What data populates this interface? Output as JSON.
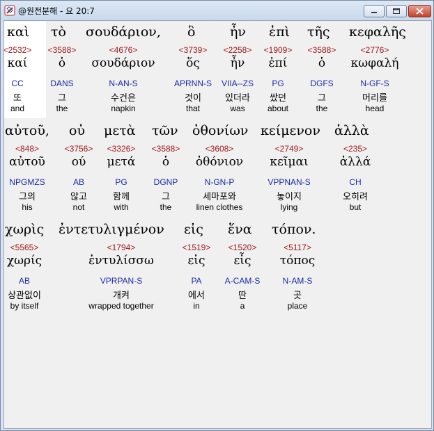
{
  "window": {
    "title": "@원전분해 - 요 20:7",
    "app_icon": "book-icon",
    "controls": [
      "minimize-icon",
      "maximize-icon",
      "close-icon"
    ]
  },
  "rows": [
    {
      "words": [
        {
          "greek": "καὶ",
          "strong": "<2532>",
          "lemma": "καί",
          "parse": "CC",
          "kor": "또",
          "eng": "and"
        },
        {
          "greek": "τὸ",
          "strong": "<3588>",
          "lemma": "ὁ",
          "parse": "DANS",
          "kor": "그",
          "eng": "the"
        },
        {
          "greek": "σουδάριον,",
          "strong": "<4676>",
          "lemma": "σουδάριον",
          "parse": "N-AN-S",
          "kor": "수건은",
          "eng": "napkin"
        },
        {
          "greek": "ὃ",
          "strong": "<3739>",
          "lemma": "ὅς",
          "parse": "APRNN-S",
          "kor": "것이",
          "eng": "that"
        },
        {
          "greek": "ἦν",
          "strong": "<2258>",
          "lemma": "ἦν",
          "parse": "VIIA--ZS",
          "kor": "있더라",
          "eng": "was"
        },
        {
          "greek": "ἐπὶ",
          "strong": "<1909>",
          "lemma": "ἐπί",
          "parse": "PG",
          "kor": "쌌던",
          "eng": "about"
        },
        {
          "greek": "τῆς",
          "strong": "<3588>",
          "lemma": "ὁ",
          "parse": "DGFS",
          "kor": "그",
          "eng": "the"
        },
        {
          "greek": "κεφαλῆς",
          "strong": "<2776>",
          "lemma": "κωφαλή",
          "parse": "N-GF-S",
          "kor": "머리를",
          "eng": "head"
        }
      ]
    },
    {
      "words": [
        {
          "greek": "αὐτοῦ,",
          "strong": "<848>",
          "lemma": "αὐτοῦ",
          "parse": "NPGMZS",
          "kor": "그의",
          "eng": "his"
        },
        {
          "greek": "οὐ",
          "strong": "<3756>",
          "lemma": "ού",
          "parse": "AB",
          "kor": "않고",
          "eng": "not"
        },
        {
          "greek": "μετὰ",
          "strong": "<3326>",
          "lemma": "μετά",
          "parse": "PG",
          "kor": "함께",
          "eng": "with"
        },
        {
          "greek": "τῶν",
          "strong": "<3588>",
          "lemma": "ὁ",
          "parse": "DGNP",
          "kor": "그",
          "eng": "the"
        },
        {
          "greek": "ὀθονίων",
          "strong": "<3608>",
          "lemma": "ὀθόνιον",
          "parse": "N-GN-P",
          "kor": "세마포와",
          "eng": "linen clothes"
        },
        {
          "greek": "κείμενον",
          "strong": "<2749>",
          "lemma": "κεῖμαι",
          "parse": "VPPNAN-S",
          "kor": "놓이지",
          "eng": "lying"
        },
        {
          "greek": "ἀλλὰ",
          "strong": "<235>",
          "lemma": "ἀλλά",
          "parse": "CH",
          "kor": "오히려",
          "eng": "but"
        }
      ]
    },
    {
      "words": [
        {
          "greek": "χωρὶς",
          "strong": "<5565>",
          "lemma": "χωρίς",
          "parse": "AB",
          "kor": "상관없이",
          "eng": "by itself"
        },
        {
          "greek": "ἐντετυλιγμένον",
          "strong": "<1794>",
          "lemma": "ἐντυλίσσω",
          "parse": "VPRPAN-S",
          "kor": "개켜",
          "eng": "wrapped together"
        },
        {
          "greek": "εἰς",
          "strong": "<1519>",
          "lemma": "εἰς",
          "parse": "PA",
          "kor": "에서",
          "eng": "in"
        },
        {
          "greek": "ἕνα",
          "strong": "<1520>",
          "lemma": "εἷς",
          "parse": "A-CAM-S",
          "kor": "딴",
          "eng": "a"
        },
        {
          "greek": "τόπον.",
          "strong": "<5117>",
          "lemma": "τόπος",
          "parse": "N-AM-S",
          "kor": "곳",
          "eng": "place"
        }
      ]
    }
  ]
}
